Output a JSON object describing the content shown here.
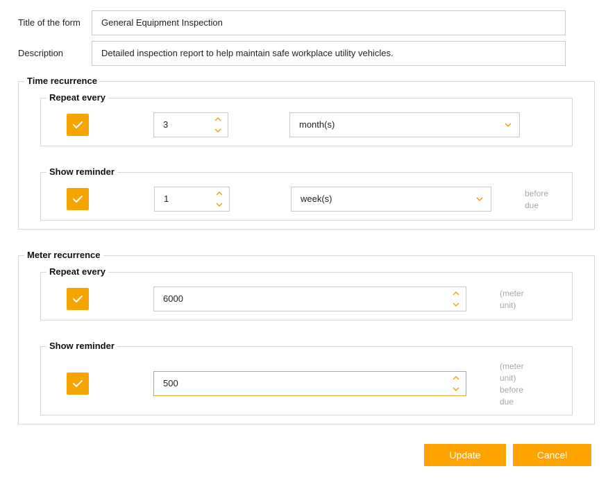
{
  "form": {
    "title_label": "Title of the form",
    "title_value": "General Equipment Inspection",
    "description_label": "Description",
    "description_value": "Detailed inspection report to help maintain safe workplace utility vehicles."
  },
  "time_recurrence": {
    "legend": "Time recurrence",
    "repeat": {
      "legend": "Repeat every",
      "checked": true,
      "value": "3",
      "unit": "month(s)"
    },
    "reminder": {
      "legend": "Show reminder",
      "checked": true,
      "value": "1",
      "unit": "week(s)",
      "hint_line1": "before",
      "hint_line2": "due"
    }
  },
  "meter_recurrence": {
    "legend": "Meter recurrence",
    "repeat": {
      "legend": "Repeat every",
      "checked": true,
      "value": "6000",
      "hint_line1": "(meter",
      "hint_line2": "unit)"
    },
    "reminder": {
      "legend": "Show reminder",
      "checked": true,
      "value": "500",
      "hint_line1": "(meter",
      "hint_line2": "unit)",
      "hint_line3": "before",
      "hint_line4": "due"
    }
  },
  "actions": {
    "update_label": "Update",
    "cancel_label": "Cancel"
  },
  "colors": {
    "accent": "#ffa300",
    "border": "#c8c8c8",
    "hint": "#a8a8a8"
  }
}
